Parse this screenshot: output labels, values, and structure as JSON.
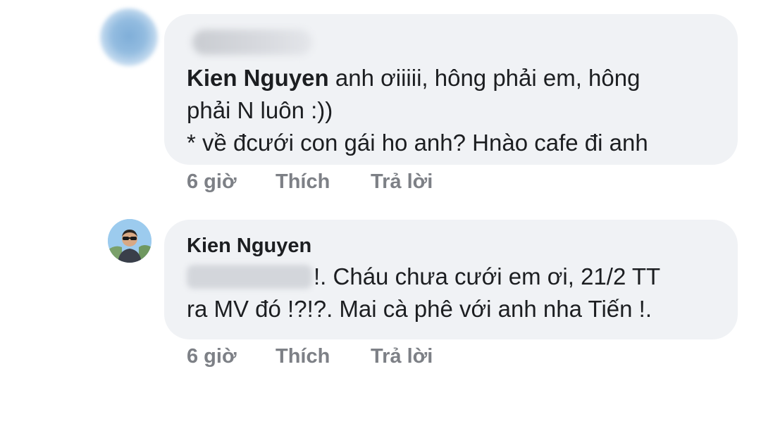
{
  "comments": [
    {
      "author": "Kien Nguyen",
      "lines": [
        "anh ơiiiii, hông phải em, hông",
        "phải N luôn :))",
        "* về đcưới con gái ho anh? Hnào cafe đi anh"
      ],
      "time": "6 giờ",
      "like_label": "Thích",
      "reply_label": "Trả lời"
    },
    {
      "author": "Kien Nguyen",
      "lines": [
        "!. Cháu chưa cưới em ơi, 21/2 TT",
        "ra MV đó !?!?. Mai cà phê với anh nha Tiến !."
      ],
      "time": "6 giờ",
      "like_label": "Thích",
      "reply_label": "Trả lời"
    }
  ]
}
